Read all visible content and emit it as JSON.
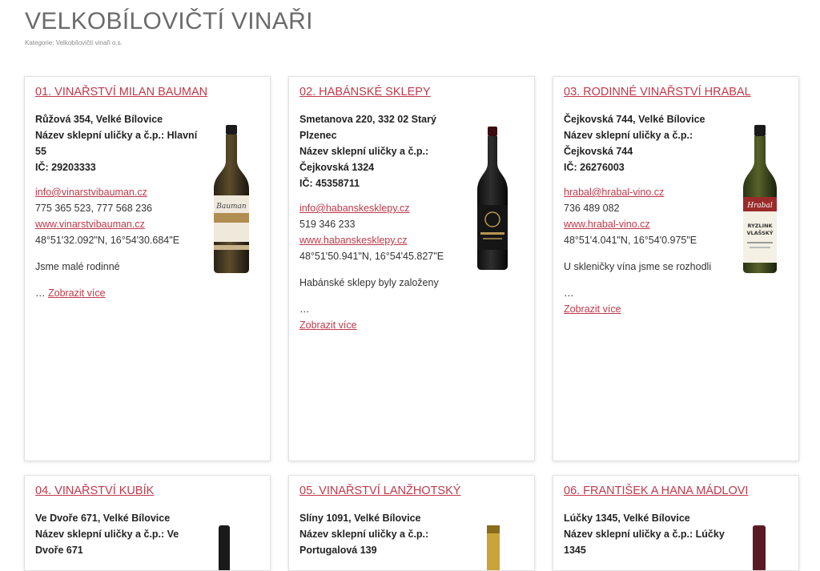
{
  "page": {
    "title": "VELKOBÍLOVIČTÍ VINAŘI",
    "category": "Kategorie: Velkobílovičtí vinaři o.s."
  },
  "wineries": [
    {
      "title": "01. VINAŘSTVÍ MILAN BAUMAN",
      "bold_lines": [
        "Růžová 354, Velké Bílovice",
        "Název sklepní uličky a č.p.: Hlavní",
        "55",
        "IČ: 29203333"
      ],
      "email": "info@vinarstvibauman.cz",
      "phone": "775 365 523, 777 568 236",
      "web": "www.vinarstvibauman.cz",
      "gps": "48°51'32.092\"N, 16°54'30.684\"E",
      "description": "Jsme malé rodinné",
      "ellipsis": "…",
      "more": "Zobrazit více",
      "bottle_label": "white-gold-label"
    },
    {
      "title": "02. HABÁNSKÉ SKLEPY",
      "bold_lines": [
        "Smetanova 220, 332 02 Starý",
        "Plzenec",
        "Název sklepní uličky a č.p.:",
        "Čejkovská 1324",
        "IČ: 45358711"
      ],
      "email": "info@habanskesklepy.cz",
      "phone": "519 346 233",
      "web": "www.habanskesklepy.cz",
      "gps": "48°51'50.941\"N, 16°54'45.827\"E",
      "description": "Habánské sklepy byly založeny",
      "ellipsis": "…",
      "more": "Zobrazit více",
      "bottle_label": "dark-label"
    },
    {
      "title": "03. RODINNÉ VINAŘSTVÍ HRABAL",
      "bold_lines": [
        "Čejkovská 744, Velké Bílovice",
        "Název sklepní uličky a č.p.:",
        "Čejkovská 744",
        "IČ: 26276003"
      ],
      "email": "hrabal@hrabal-vino.cz",
      "phone": "736 489 082",
      "web": "www.hrabal-vino.cz",
      "gps": "48°51'4.041\"N, 16°54'0.975\"E",
      "description": "U skleničky vína jsme se rozhodli",
      "ellipsis": "…",
      "more": "Zobrazit více",
      "bottle_label": "Ryzlink Vlašský"
    },
    {
      "title": "04. VINAŘSTVÍ KUBÍK",
      "bold_lines": [
        "Ve Dvoře 671, Velké Bílovice",
        "Název sklepní uličky a č.p.: Ve",
        "Dvoře 671"
      ]
    },
    {
      "title": "05. VINAŘSTVÍ LANŽHOTSKÝ",
      "bold_lines": [
        "Slíny 1091, Velké Bílovice",
        "Název sklepní uličky a č.p.:",
        "Portugalová 139"
      ]
    },
    {
      "title": "06. FRANTIŠEK A HANA MÁDLOVI",
      "bold_lines": [
        "Lúčky 1345, Velké Bílovice",
        "Název sklepní uličky a č.p.: Lúčky",
        "1345"
      ]
    }
  ],
  "colors": {
    "link": "#c0394b",
    "title": "#6b6b6b"
  }
}
